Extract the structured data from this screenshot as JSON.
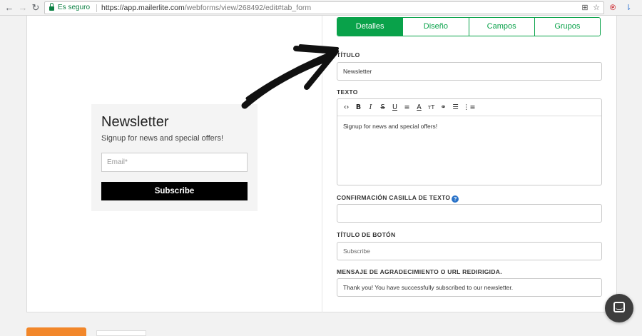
{
  "browser": {
    "secure_label": "Es seguro",
    "url_host": "https://app.mailerlite.com",
    "url_path": "/webforms/view/268492/edit#tab_form"
  },
  "preview": {
    "title": "Newsletter",
    "subtitle": "Signup for news and special offers!",
    "email_placeholder": "Email*",
    "button_label": "Subscribe"
  },
  "tabs": [
    {
      "label": "Detalles",
      "active": true
    },
    {
      "label": "Diseño",
      "active": false
    },
    {
      "label": "Campos",
      "active": false
    },
    {
      "label": "Grupos",
      "active": false
    }
  ],
  "form": {
    "title_label": "Título",
    "title_value": "Newsletter",
    "text_label": "Texto",
    "text_value": "Signup for news and special offers!",
    "checkbox_label": "Confirmación casilla de texto",
    "checkbox_value": "",
    "button_title_label": "Título de botón",
    "button_title_value": "Subscribe",
    "thanks_label": "Mensaje de agradecimiento o URL redirigida.",
    "thanks_value": "Thank you! You have successfully subscribed to our newsletter."
  },
  "toolbar_icons": [
    "code-icon",
    "bold-icon",
    "italic-icon",
    "strikethrough-icon",
    "underline-icon",
    "align-icon",
    "text-color-icon",
    "font-size-icon",
    "link-icon",
    "bullet-list-icon",
    "numbered-list-icon"
  ]
}
